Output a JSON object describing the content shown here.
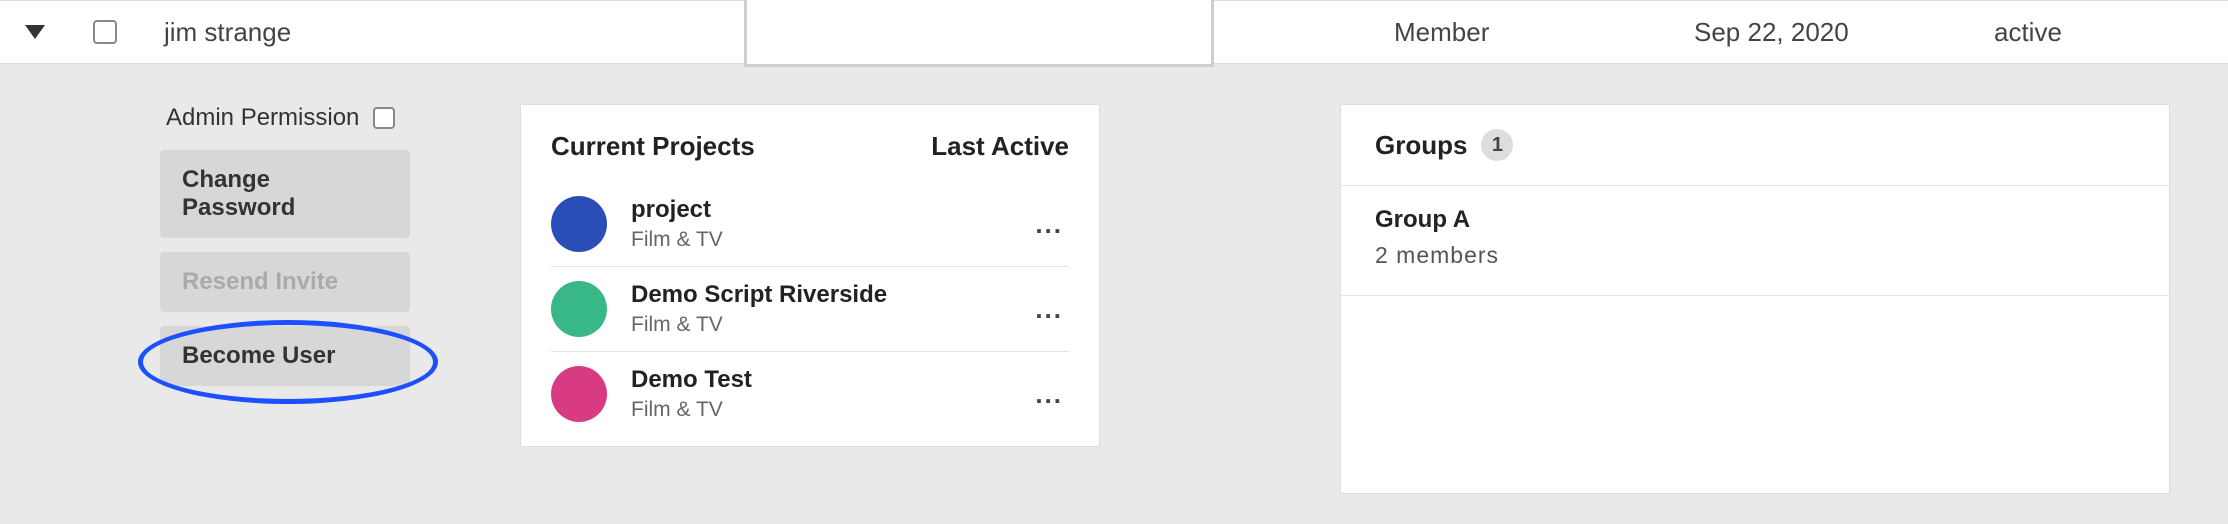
{
  "row": {
    "name": "jim strange",
    "role": "Member",
    "date": "Sep 22, 2020",
    "status": "active"
  },
  "admin": {
    "perm_label": "Admin Permission",
    "change_password": "Change Password",
    "resend_invite": "Resend Invite",
    "become_user": "Become User"
  },
  "projects": {
    "title": "Current Projects",
    "last_active": "Last Active",
    "items": [
      {
        "name": "project",
        "category": "Film & TV",
        "color": "#2b4db8",
        "last": "..."
      },
      {
        "name": "Demo Script Riverside",
        "category": "Film & TV",
        "color": "#37b886",
        "last": "..."
      },
      {
        "name": "Demo Test",
        "category": "Film & TV",
        "color": "#d93b82",
        "last": "..."
      }
    ]
  },
  "groups": {
    "title": "Groups",
    "count": "1",
    "items": [
      {
        "name": "Group A",
        "members": "2 members"
      }
    ]
  }
}
